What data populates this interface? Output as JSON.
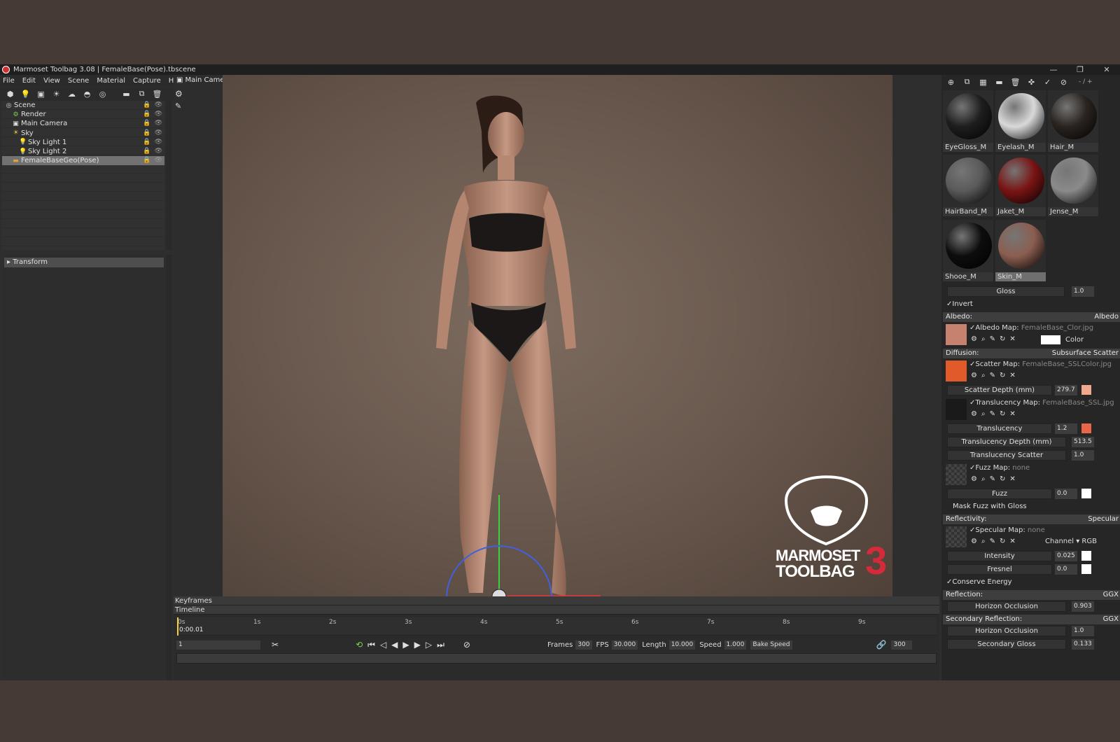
{
  "window": {
    "title": "Marmoset Toolbag 3.08  |  FemaleBase(Pose).tbscene",
    "controls": [
      "—",
      "❐",
      "✕"
    ]
  },
  "menu": [
    "File",
    "Edit",
    "View",
    "Scene",
    "Material",
    "Capture",
    "Help"
  ],
  "toolbar_icons": [
    "cube-icon",
    "bulb-icon",
    "camera-icon",
    "sky-icon",
    "cloud-icon",
    "shadow-icon",
    "sphere-icon",
    "folder-icon",
    "duplicate-icon",
    "trash-icon"
  ],
  "scene_tree": [
    {
      "label": "Scene",
      "icon": "scene-icon",
      "indent": 0
    },
    {
      "label": "Render",
      "icon": "render-icon",
      "indent": 1
    },
    {
      "label": "Main Camera",
      "icon": "camera-icon",
      "indent": 1
    },
    {
      "label": "Sky",
      "icon": "sky-icon",
      "indent": 1
    },
    {
      "label": "Sky Light 1",
      "icon": "light-icon",
      "indent": 2
    },
    {
      "label": "Sky Light 2",
      "icon": "light-icon",
      "indent": 2
    },
    {
      "label": "FemaleBaseGeo(Pose)",
      "icon": "folder-icon",
      "indent": 1,
      "selected": true
    }
  ],
  "transform_label": "Transform",
  "viewport": {
    "camera": "Main Camera ▾",
    "logo_line1": "MARMOSET",
    "logo_line2": "TOOLBAG",
    "logo_num": "3"
  },
  "timeline": {
    "keyframes_label": "Keyframes",
    "timeline_label": "Timeline",
    "ticks": [
      "0s",
      "1s",
      "2s",
      "3s",
      "4s",
      "5s",
      "6s",
      "7s",
      "8s",
      "9s"
    ],
    "current_time": "0:00.01",
    "frame_field": "1",
    "frames_label": "Frames",
    "frames": "300",
    "fps_label": "FPS",
    "fps": "30.000",
    "length_label": "Length",
    "length": "10.000",
    "speed_label": "Speed",
    "speed": "1.000",
    "bake_label": "Bake Speed",
    "end_frame": "300"
  },
  "mat_tools": {
    "icons": [
      "add-icon",
      "duplicate-icon",
      "grid-icon",
      "folder-icon",
      "trash-icon",
      "pick-icon",
      "check-icon",
      "bake-icon"
    ],
    "field": "- / +"
  },
  "materials": [
    {
      "name": "EyeGloss_M",
      "color": "#1e1e1e"
    },
    {
      "name": "Eyelash_M",
      "color": "#d9d9d9"
    },
    {
      "name": "Hair_M",
      "color": "#2a2420"
    },
    {
      "name": "HairBand_M",
      "color": "#5a5a5a"
    },
    {
      "name": "Jaket_M",
      "color": "#7a1414"
    },
    {
      "name": "Jense_M",
      "color": "#8a8a8a"
    },
    {
      "name": "Shooe_M",
      "color": "#0d0d0d"
    },
    {
      "name": "Skin_M",
      "color": "#8b5e50",
      "selected": true
    }
  ],
  "props": {
    "gloss_label": "Gloss",
    "gloss_val": "1.0",
    "invert_label": "✓Invert",
    "albedo_hdr": "Albedo:",
    "albedo_mode": "Albedo",
    "albedo_map_label": "✓Albedo Map:",
    "albedo_map_file": "FemaleBase_Clor.jpg",
    "color_label": "Color",
    "diffusion_hdr": "Diffusion:",
    "diffusion_mode": "Subsurface Scatter",
    "scatter_map_label": "✓Scatter Map:",
    "scatter_map_file": "FemaleBase_SSLColor.jpg",
    "scatter_depth_label": "Scatter Depth (mm)",
    "scatter_depth_val": "279.7",
    "transl_map_label": "✓Translucency Map:",
    "transl_map_file": "FemaleBase_SSL.jpg",
    "translucency_label": "Translucency",
    "translucency_val": "1.2",
    "transl_depth_label": "Translucency Depth (mm)",
    "transl_depth_val": "513.5",
    "transl_scatter_label": "Translucency Scatter",
    "transl_scatter_val": "1.0",
    "fuzz_map_label": "✓Fuzz Map:",
    "fuzz_map_file": "none",
    "fuzz_label": "Fuzz",
    "fuzz_val": "0.0",
    "mask_fuzz_label": "Mask Fuzz with Gloss",
    "reflectivity_hdr": "Reflectivity:",
    "reflectivity_mode": "Specular",
    "spec_map_label": "✓Specular Map:",
    "spec_map_file": "none",
    "channel_label": "Channel ▾ RGB",
    "intensity_label": "Intensity",
    "intensity_val": "0.025",
    "fresnel_label": "Fresnel",
    "fresnel_val": "0.0",
    "conserve_label": "✓Conserve Energy",
    "reflection_hdr": "Reflection:",
    "reflection_mode": "GGX",
    "horizon_label": "Horizon Occlusion",
    "horizon_val": "0.903",
    "sec_reflection_hdr": "Secondary Reflection:",
    "sec_reflection_mode": "GGX",
    "horizon2_label": "Horizon Occlusion",
    "horizon2_val": "1.0",
    "sec_gloss_label": "Secondary Gloss",
    "sec_gloss_val": "0.133"
  },
  "colors": {
    "accent_red": "#d42a3a",
    "albedo_swatch": "#ffffff",
    "scatter_swatch": "#f0a88c",
    "transl_swatch": "#e8674a",
    "fuzz_swatch": "#ffffff"
  }
}
